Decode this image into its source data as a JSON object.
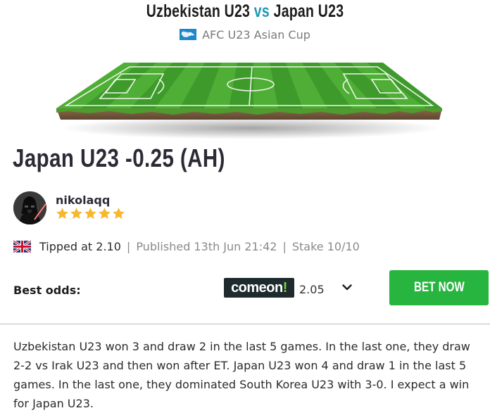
{
  "match": {
    "home": "Uzbekistan U23",
    "vs": "vs",
    "away": "Japan U23"
  },
  "league": {
    "name": "AFC U23 Asian Cup",
    "flag_icon": "asia-map-flag-icon"
  },
  "pitch_icon": "football-pitch-image",
  "tip": {
    "title": "Japan U23 -0.25 (AH)"
  },
  "tipster": {
    "username": "nikolaqq",
    "rating": 5,
    "rating_max": 5,
    "avatar_icon": "darth-vader-avatar"
  },
  "tip_details": {
    "flag_icon": "uk-flag-icon",
    "tipped_at": "Tipped at 2.10",
    "separator": "|",
    "published": "Published 13th Jun 21:42",
    "stake": "Stake 10/10"
  },
  "best_odds": {
    "label": "Best odds:",
    "bookmaker_name": "comeon",
    "bookmaker_suffix": "!",
    "odds": "2.05",
    "expand_icon": "chevron-down-icon"
  },
  "bet_button": {
    "label": "BET NOW"
  },
  "analysis": {
    "text": "Uzbekistan U23 won 3 and draw 2 in the last 5 games. In the last one, they draw 2-2 vs Irak U23 and then won after ET. Japan U23 won 4 and draw 1 in the last 5 games. In the last one, they dominated South Korea U23 with 3-0. I expect a win for Japan U23."
  },
  "colors": {
    "vs_accent": "#1e9ab3",
    "bet_button": "#27b53f",
    "star": "#f5b82e",
    "pitch_green": "#3f9a2c"
  }
}
